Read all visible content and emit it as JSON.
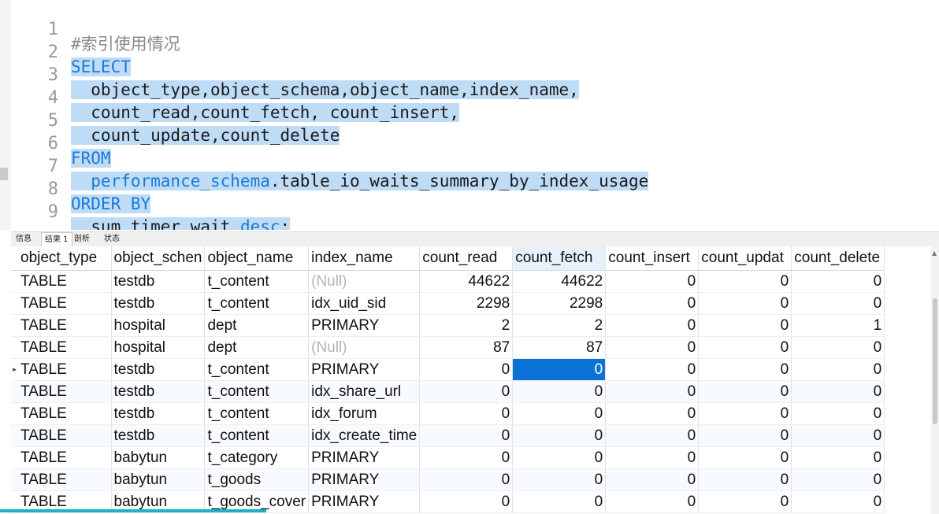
{
  "editor": {
    "line_numbers": [
      "1",
      "2",
      "3",
      "4",
      "5",
      "6",
      "7",
      "8",
      "9"
    ],
    "line1": {
      "comment": "#索引使用情况"
    },
    "line2": {
      "kw": "SELECT"
    },
    "line3": {
      "text": "  object_type,object_schema,object_name,index_name,"
    },
    "line4": {
      "text": "  count_read,count_fetch, count_insert,"
    },
    "line5": {
      "text": "  count_update,count_delete"
    },
    "line6": {
      "kw": "FROM"
    },
    "line7": {
      "kw": "  performance_schema",
      "text": ".table_io_waits_summary_by_index_usage"
    },
    "line8": {
      "kw": "ORDER BY"
    },
    "line9": {
      "text_a": "  sum_timer_wait ",
      "kw": "desc",
      "text_b": ";"
    }
  },
  "tabs": [
    "信息",
    "结果 1",
    "剖析",
    "状态"
  ],
  "grid": {
    "columns": [
      "object_type",
      "object_schen",
      "object_name",
      "index_name",
      "count_read",
      "count_fetch",
      "count_insert",
      "count_updat",
      "count_delete"
    ],
    "rows": [
      [
        "TABLE",
        "testdb",
        "t_content",
        "(Null)",
        "44622",
        "44622",
        "0",
        "0",
        "0"
      ],
      [
        "TABLE",
        "testdb",
        "t_content",
        "idx_uid_sid",
        "2298",
        "2298",
        "0",
        "0",
        "0"
      ],
      [
        "TABLE",
        "hospital",
        "dept",
        "PRIMARY",
        "2",
        "2",
        "0",
        "0",
        "1"
      ],
      [
        "TABLE",
        "hospital",
        "dept",
        "(Null)",
        "87",
        "87",
        "0",
        "0",
        "0"
      ],
      [
        "TABLE",
        "testdb",
        "t_content",
        "PRIMARY",
        "0",
        "0",
        "0",
        "0",
        "0"
      ],
      [
        "TABLE",
        "testdb",
        "t_content",
        "idx_share_url",
        "0",
        "0",
        "0",
        "0",
        "0"
      ],
      [
        "TABLE",
        "testdb",
        "t_content",
        "idx_forum",
        "0",
        "0",
        "0",
        "0",
        "0"
      ],
      [
        "TABLE",
        "testdb",
        "t_content",
        "idx_create_time",
        "0",
        "0",
        "0",
        "0",
        "0"
      ],
      [
        "TABLE",
        "babytun",
        "t_category",
        "PRIMARY",
        "0",
        "0",
        "0",
        "0",
        "0"
      ],
      [
        "TABLE",
        "babytun",
        "t_goods",
        "PRIMARY",
        "0",
        "0",
        "0",
        "0",
        "0"
      ],
      [
        "TABLE",
        "babytun",
        "t_goods_cover",
        "PRIMARY",
        "0",
        "0",
        "0",
        "0",
        "0"
      ]
    ],
    "current_row_marker": "▸"
  },
  "colors": {
    "keyword": "#1a79d6",
    "selection": "#bfdcf7",
    "cell_selected": "#0a72d6",
    "null_text": "#b4b4b4"
  }
}
